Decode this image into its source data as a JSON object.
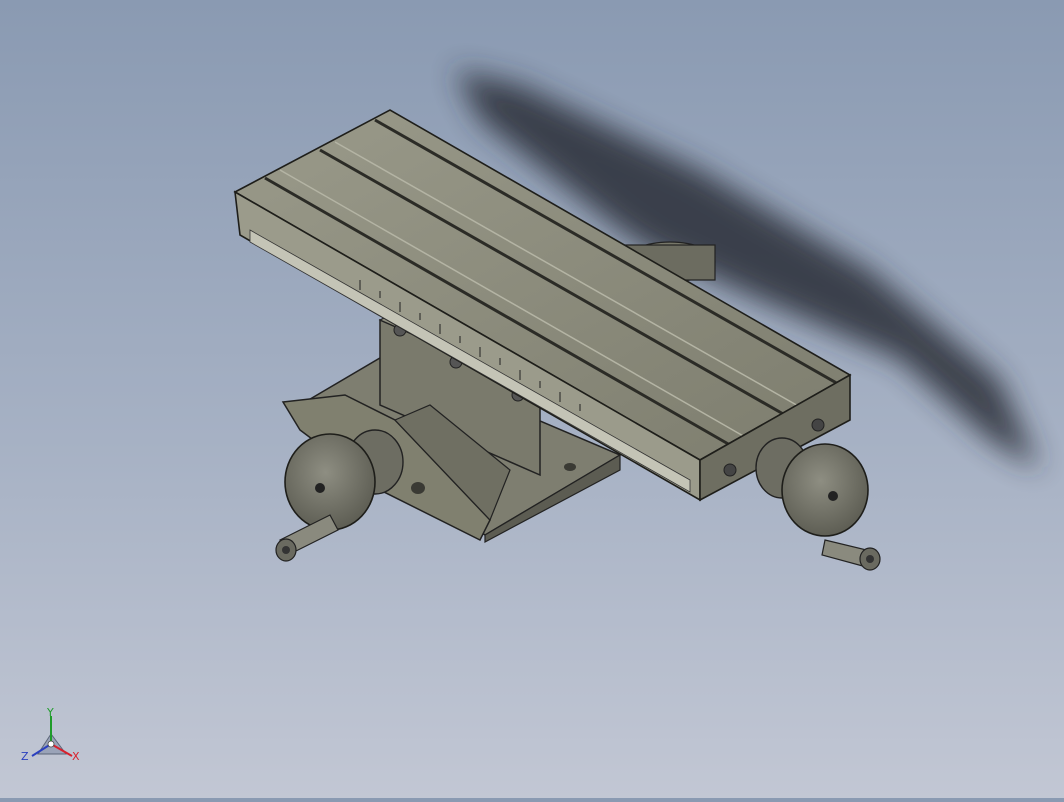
{
  "viewport": {
    "background_top": "#8a9ab2",
    "background_bottom": "#c2c7d4",
    "part_color": "#8b8b7c",
    "shadow_color": "#2a2f38"
  },
  "triad": {
    "x_label": "X",
    "y_label": "Y",
    "z_label": "Z",
    "x_color": "#d8202c",
    "y_color": "#1f9c2a",
    "z_color": "#2a3fbf"
  }
}
